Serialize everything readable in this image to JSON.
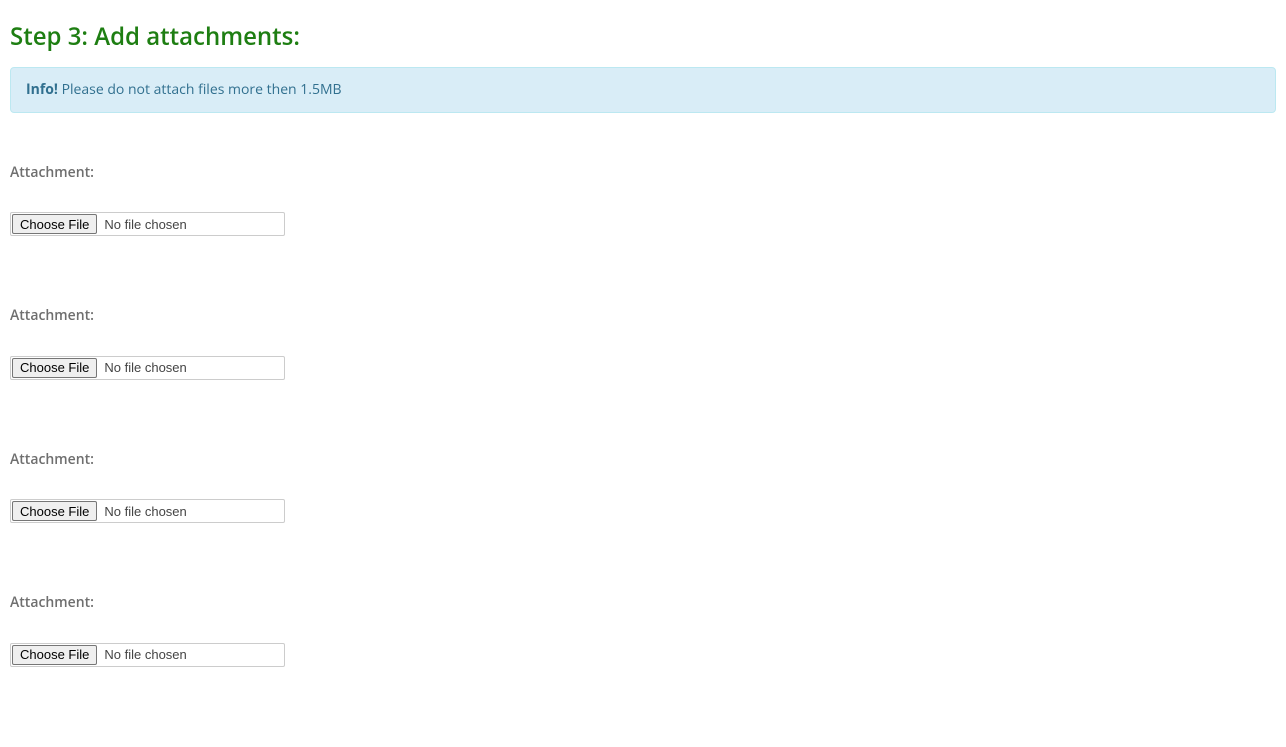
{
  "heading": "Step 3: Add attachments:",
  "alert": {
    "strong": "Info!",
    "text": " Please do not attach files more then 1.5MB"
  },
  "attachments": [
    {
      "label": "Attachment:",
      "button": "Choose File",
      "status": "No file chosen"
    },
    {
      "label": "Attachment:",
      "button": "Choose File",
      "status": "No file chosen"
    },
    {
      "label": "Attachment:",
      "button": "Choose File",
      "status": "No file chosen"
    },
    {
      "label": "Attachment:",
      "button": "Choose File",
      "status": "No file chosen"
    }
  ]
}
